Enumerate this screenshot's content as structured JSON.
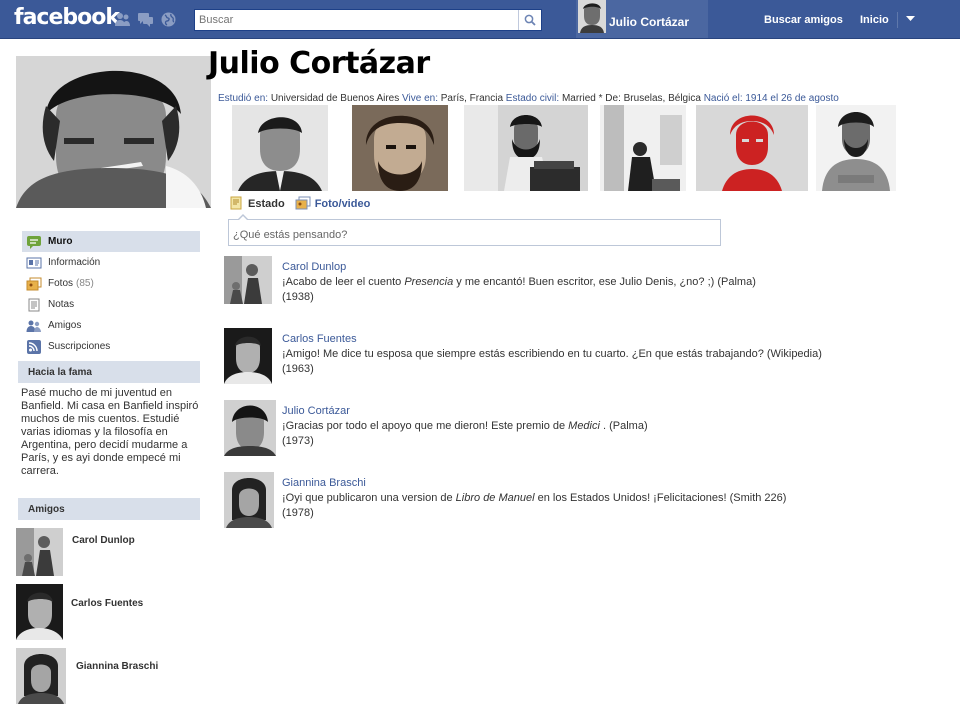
{
  "header": {
    "logo": "facebook",
    "search_placeholder": "Buscar",
    "user_name": "Julio Cortázar",
    "nav": {
      "find_friends": "Buscar amigos",
      "home": "Inicio"
    }
  },
  "profile": {
    "name": "Julio Cortázar",
    "info": [
      {
        "label": "Estudió en:",
        "value": "Universidad de Buenos Aires"
      },
      {
        "label": "Vive en:",
        "value": "París, Francia"
      },
      {
        "label": "Estado civil:",
        "value": "Married"
      },
      {
        "label": "De:",
        "value": "Bruselas, Bélgica"
      },
      {
        "label": "Nació el:",
        "value": "1914 el 26 de agosto"
      }
    ]
  },
  "sidebar": {
    "items": [
      {
        "label": "Muro",
        "icon": "wall-icon",
        "active": true
      },
      {
        "label": "Información",
        "icon": "info-icon"
      },
      {
        "label": "Fotos",
        "count": "(85)",
        "icon": "photos-icon"
      },
      {
        "label": "Notas",
        "icon": "notes-icon"
      },
      {
        "label": "Amigos",
        "icon": "friends-icon"
      },
      {
        "label": "Suscripciones",
        "icon": "subscriptions-icon"
      }
    ]
  },
  "about": {
    "title": "Hacia la fama",
    "text": "Pasé mucho de mi juventud en Banfield. Mi casa en Banfield inspiró muchos de mis cuentos. Estudié varias idiomas y la filosofía en Argentina, pero decidí mudarme a París, y es ayi donde empecé mi carrera."
  },
  "friends": {
    "title": "Amigos",
    "list": [
      {
        "name": "Carol Dunlop"
      },
      {
        "name": "Carlos Fuentes"
      },
      {
        "name": "Giannina Braschi"
      }
    ]
  },
  "composer": {
    "tab_status": "Estado",
    "tab_photo": "Foto/video",
    "placeholder": "¿Qué estás pensando?"
  },
  "posts": [
    {
      "author": "Carol Dunlop",
      "pre": "¡Acabo de leer el cuento ",
      "italic": "Presencia",
      "post": " y me encantó! Buen escritor, ese Julio Denis, ¿no? ;) (Palma)",
      "year": "(1938)"
    },
    {
      "author": "Carlos Fuentes",
      "pre": "¡Amigo! Me dice tu esposa que siempre estás escribiendo en tu cuarto. ¿En que estás trabajando?  (Wikipedia)",
      "italic": "",
      "post": "",
      "year": "(1963)"
    },
    {
      "author": "Julio Cortázar",
      "pre": "¡Gracias por todo el apoyo que me dieron! Este premio de ",
      "italic": "Medici",
      "post": " .  (Palma)",
      "year": "(1973)"
    },
    {
      "author": "Giannina  Braschi",
      "pre": "¡Oyi que publicaron una version de ",
      "italic": "Libro de Manuel",
      "post": " en los Estados Unidos! ¡Felicitaciones! (Smith 226)",
      "year": "(1978)"
    }
  ],
  "colors": {
    "brand": "#3b5998",
    "nav_active": "#d8dfea",
    "text": "#333333"
  }
}
